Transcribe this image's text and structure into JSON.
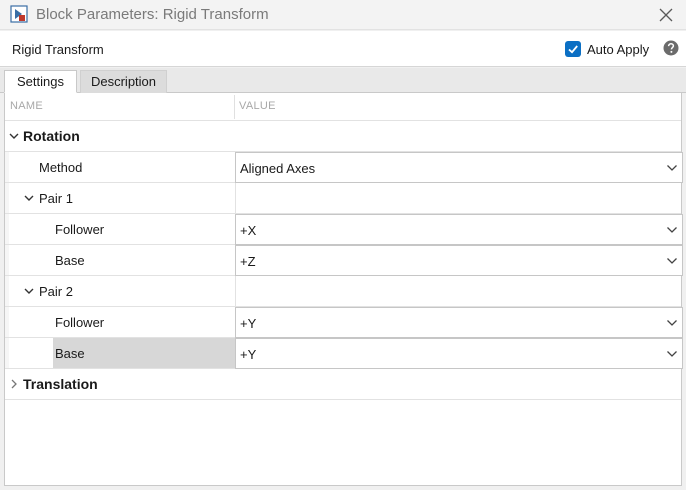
{
  "window": {
    "title": "Block Parameters: Rigid Transform",
    "app_icon": "simulink-block-icon",
    "close_icon": "close-icon"
  },
  "block": {
    "name": "Rigid Transform",
    "auto_apply_label": "Auto Apply",
    "auto_apply_checked": true,
    "help_icon": "help-icon"
  },
  "tabs": [
    {
      "label": "Settings",
      "active": true
    },
    {
      "label": "Description",
      "active": false
    }
  ],
  "table": {
    "col_name": "NAME",
    "col_value": "VALUE"
  },
  "rows": {
    "rotation": {
      "label": "Rotation",
      "expanded": true
    },
    "method": {
      "label": "Method",
      "value": "Aligned Axes"
    },
    "pair1": {
      "label": "Pair 1",
      "expanded": true
    },
    "pair1_follower": {
      "label": "Follower",
      "value": "+X"
    },
    "pair1_base": {
      "label": "Base",
      "value": "+Z"
    },
    "pair2": {
      "label": "Pair 2",
      "expanded": true
    },
    "pair2_follower": {
      "label": "Follower",
      "value": "+Y"
    },
    "pair2_base": {
      "label": "Base",
      "value": "+Y",
      "selected": true
    },
    "translation": {
      "label": "Translation",
      "expanded": false
    }
  },
  "colors": {
    "accent": "#0b6fc4",
    "selected_row": "#d7d7d7"
  }
}
